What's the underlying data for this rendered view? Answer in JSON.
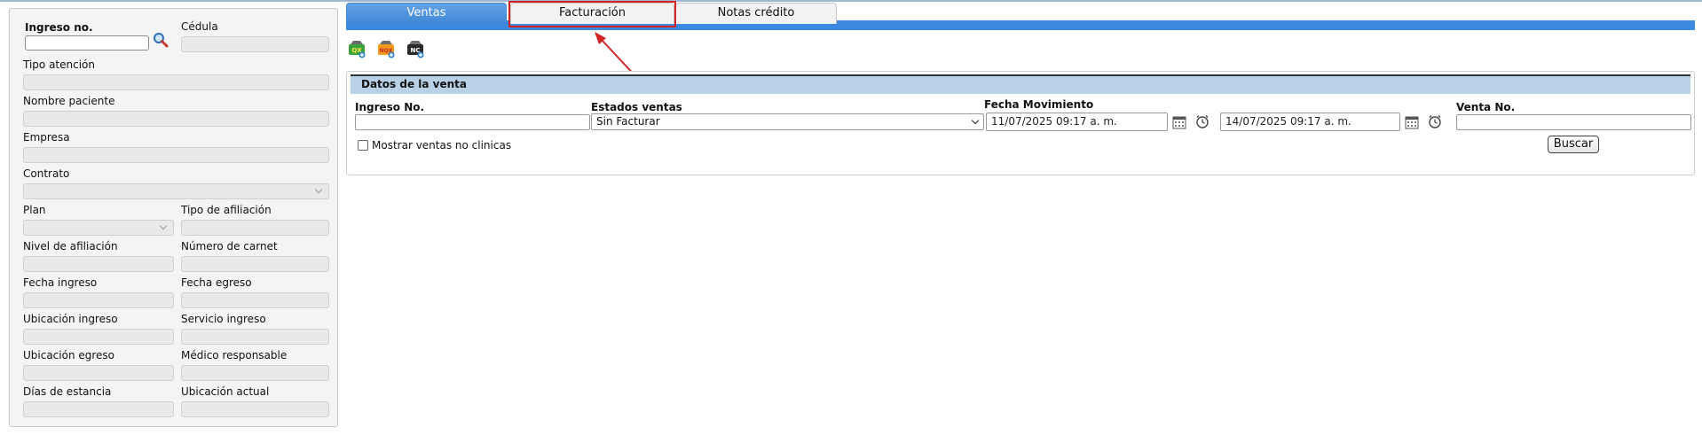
{
  "patient": {
    "ingreso_label": "Ingreso no.",
    "ingreso_value": "",
    "cedula_label": "Cédula",
    "tipo_atencion_label": "Tipo atención",
    "nombre_paciente_label": "Nombre paciente",
    "empresa_label": "Empresa",
    "contrato_label": "Contrato",
    "plan_label": "Plan",
    "tipo_afiliacion_label": "Tipo de afiliación",
    "nivel_afiliacion_label": "Nivel de afiliación",
    "numero_carnet_label": "Número de carnet",
    "fecha_ingreso_label": "Fecha ingreso",
    "fecha_egreso_label": "Fecha egreso",
    "ubicacion_ingreso_label": "Ubicación ingreso",
    "servicio_ingreso_label": "Servicio ingreso",
    "ubicacion_egreso_label": "Ubicación egreso",
    "medico_responsable_label": "Médico responsable",
    "dias_estancia_label": "Días de estancia",
    "ubicacion_actual_label": "Ubicación actual"
  },
  "tabs": [
    {
      "label": "Ventas",
      "active": true
    },
    {
      "label": "Facturación",
      "active": false
    },
    {
      "label": "Notas crédito",
      "active": false
    }
  ],
  "toolbar": {
    "icons": [
      {
        "name": "qx-icon",
        "text": "QX",
        "color": "#3aa33a"
      },
      {
        "name": "nqx-icon",
        "text": "NQX",
        "color": "#f39a1e"
      },
      {
        "name": "nc-icon",
        "text": "NC",
        "color": "#2b2b2b"
      }
    ]
  },
  "venta": {
    "title": "Datos de la venta",
    "ingreso_label": "Ingreso No.",
    "ingreso_value": "",
    "estados_label": "Estados ventas",
    "estados_value": "Sin Facturar",
    "fecha_label": "Fecha Movimiento",
    "fecha_desde": "11/07/2025 09:17 a. m.",
    "fecha_hasta": "14/07/2025 09:17 a. m.",
    "venta_no_label": "Venta No.",
    "venta_no_value": "",
    "mostrar_label": "Mostrar ventas no clinicas",
    "buscar_label": "Buscar"
  },
  "colors": {
    "accent": "#3c8ae0",
    "highlight": "#d32424"
  }
}
